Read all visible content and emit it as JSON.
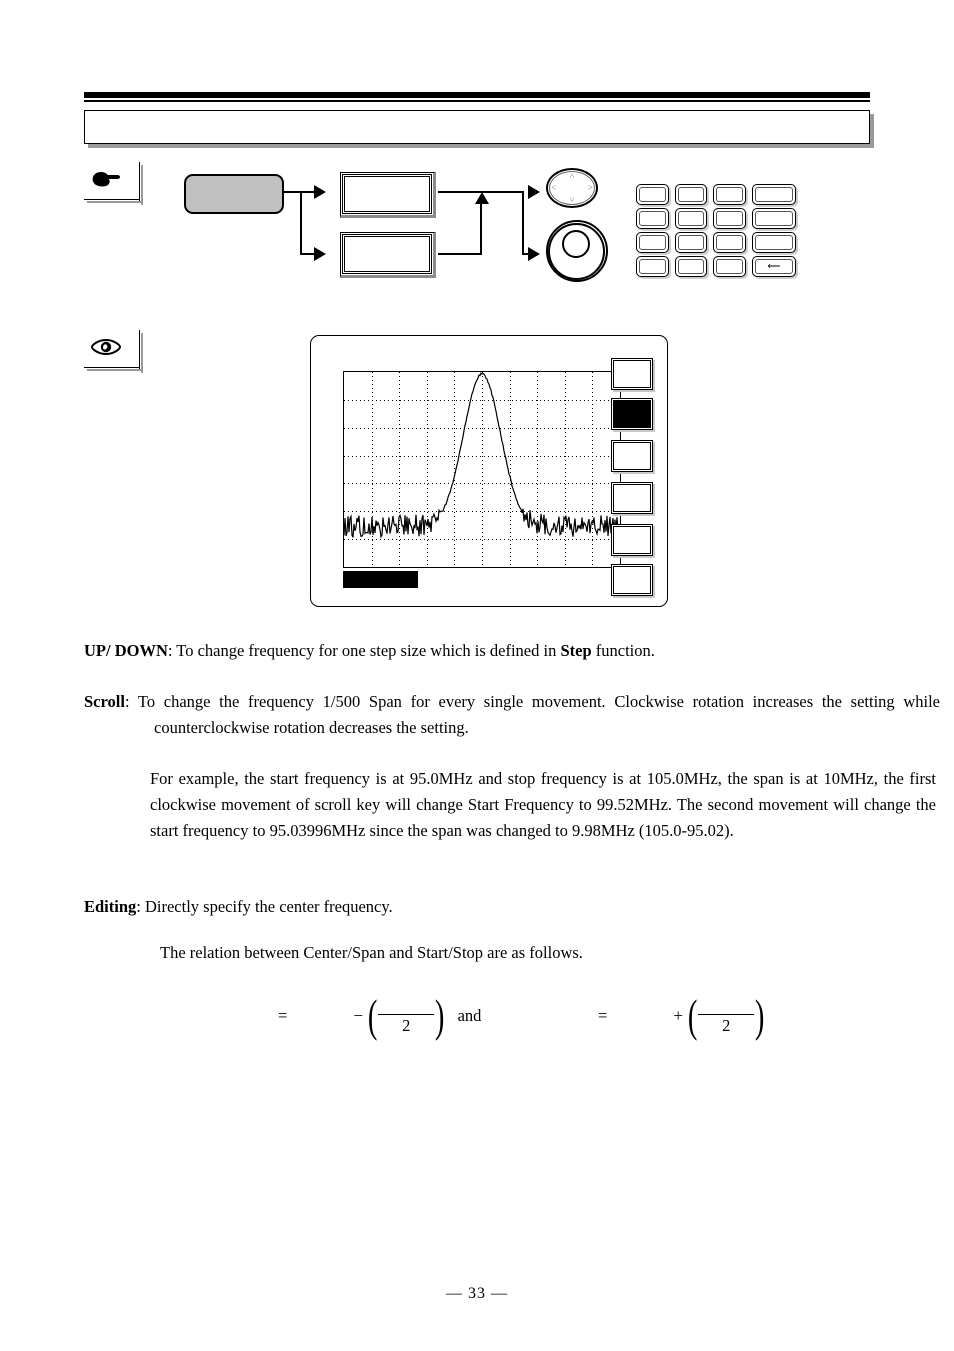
{
  "header": {
    "title": ""
  },
  "marks": {
    "operation_icon": "pointing-hand-icon",
    "display_icon": "eye-icon"
  },
  "flow_diagram": {
    "source_label": "",
    "box_a_label": "",
    "box_b_label": "",
    "navpad": {
      "up": "˄",
      "down": "˅",
      "left": "˂",
      "right": "˃"
    },
    "keypad": {
      "rows": [
        [
          {
            "label": "",
            "wide": false
          },
          {
            "label": "",
            "wide": false
          },
          {
            "label": "",
            "wide": false
          },
          {
            "label": "",
            "wide": true
          }
        ],
        [
          {
            "label": "",
            "wide": false
          },
          {
            "label": "",
            "wide": false
          },
          {
            "label": "",
            "wide": false
          },
          {
            "label": "",
            "wide": true
          }
        ],
        [
          {
            "label": "",
            "wide": false
          },
          {
            "label": "",
            "wide": false
          },
          {
            "label": "",
            "wide": false
          },
          {
            "label": "",
            "wide": true
          }
        ],
        [
          {
            "label": "",
            "wide": false
          },
          {
            "label": "",
            "wide": false
          },
          {
            "label": "",
            "wide": false
          },
          {
            "label": "⟵",
            "wide": true
          }
        ]
      ]
    }
  },
  "instrument": {
    "status_bar_text": "",
    "softkeys": [
      {
        "label": "",
        "selected": false
      },
      {
        "label": "",
        "selected": true
      },
      {
        "label": "",
        "selected": false
      },
      {
        "label": "",
        "selected": false
      },
      {
        "label": "",
        "selected": false
      },
      {
        "label": "",
        "selected": false
      }
    ]
  },
  "chart_data": {
    "type": "line",
    "title": "",
    "xlabel": "",
    "ylabel": "",
    "grid": true,
    "grid_cols": 10,
    "grid_rows": 7,
    "description": "Spectrum analyzer trace: flat noise floor near the bottom of the graticule with a single tall narrow peak centred horizontally, reaching the top of the graticule.",
    "xlim": [
      0,
      276
    ],
    "ylim": [
      0,
      195
    ],
    "noise_floor_level": 0.2,
    "peak_center_fraction": 0.5,
    "peak_height_fraction": 1.0,
    "peak_width_fraction": 0.16
  },
  "body": {
    "p1_lead": "UP/ DOWN",
    "p1_mid": ": To change frequency for one step size which is defined in ",
    "p1_bold2": "Step",
    "p1_end": " function.",
    "p2_lead": "Scroll",
    "p2_text": ": To change the frequency 1/500 Span for every single movement. Clockwise rotation increases the setting while counterclockwise rotation decreases the setting.",
    "p3_text": "For example, the start frequency is at 95.0MHz and stop frequency is at 105.0MHz, the span is at 10MHz, the first clockwise movement of scroll key will change Start Frequency to 99.52MHz. The second movement will change the start frequency to 95.03996MHz since the span was changed to 9.98MHz (105.0-95.02).",
    "p4_lead": "Editing",
    "p4_text": ": Directly specify the center frequency.",
    "p5_text": "The relation between Center/Span and Start/Stop are as follows."
  },
  "formula": {
    "left": {
      "lhs": "",
      "equals": "=",
      "sign": "−",
      "numerator": "",
      "denominator": "2",
      "conjunction": "and"
    },
    "right": {
      "lhs": "",
      "equals": "=",
      "sign": "+",
      "numerator": "",
      "denominator": "2"
    }
  },
  "footer": {
    "page": "—  33 —"
  }
}
